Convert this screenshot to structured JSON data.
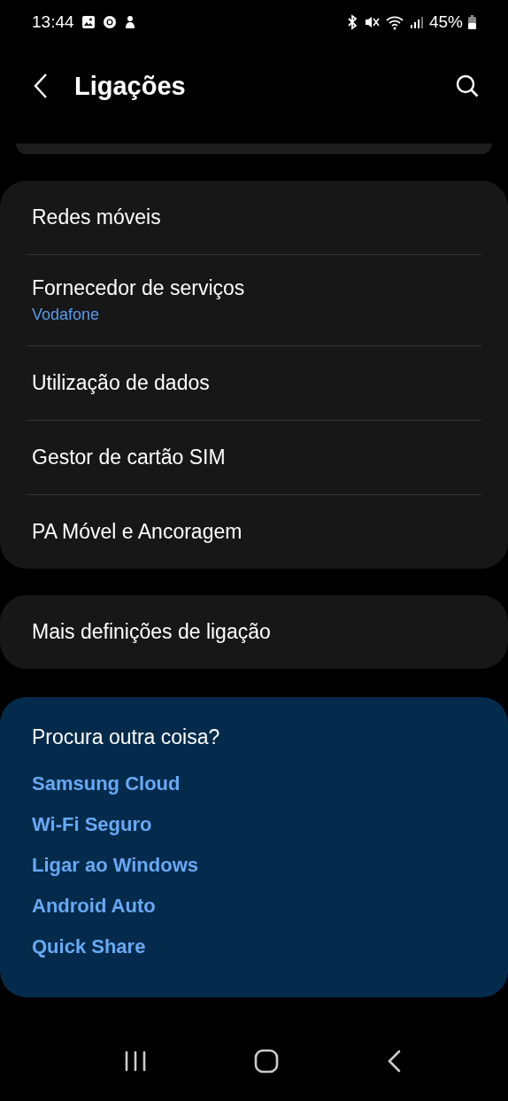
{
  "status_bar": {
    "time": "13:44",
    "battery": "45%"
  },
  "header": {
    "title": "Ligações"
  },
  "groups": [
    {
      "items": [
        {
          "title": "Redes móveis"
        },
        {
          "title": "Fornecedor de serviços",
          "subtitle": "Vodafone"
        },
        {
          "title": "Utilização de dados"
        },
        {
          "title": "Gestor de cartão SIM"
        },
        {
          "title": "PA Móvel e Ancoragem"
        }
      ]
    },
    {
      "items": [
        {
          "title": "Mais definições de ligação"
        }
      ]
    }
  ],
  "suggestions": {
    "title": "Procura outra coisa?",
    "links": [
      "Samsung Cloud",
      "Wi-Fi Seguro",
      "Ligar ao Windows",
      "Android Auto",
      "Quick Share"
    ]
  }
}
